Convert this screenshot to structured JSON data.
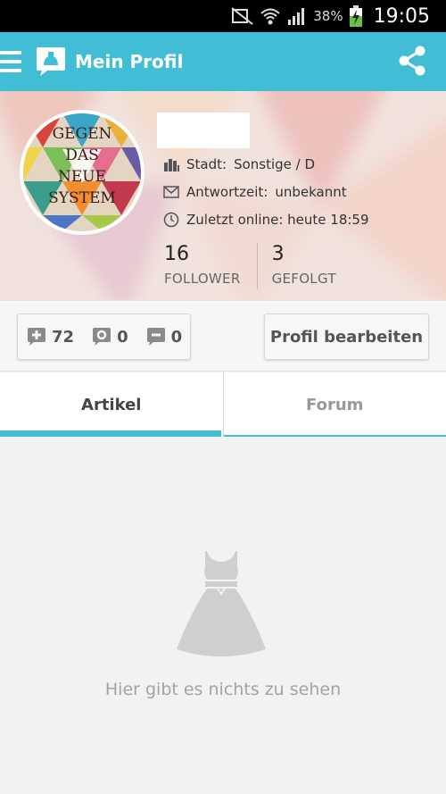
{
  "status_bar": {
    "battery": "38%",
    "time": "19:05"
  },
  "app_bar": {
    "title": "Mein Profil"
  },
  "profile": {
    "avatar_text": [
      "GEGEN",
      "DAS",
      "NEUE",
      "SYSTEM"
    ],
    "city_label": "Stadt:",
    "city_value": "Sonstige / D",
    "response_label": "Antwortzeit:",
    "response_value": "unbekannt",
    "online_text": "Zuletzt online: heute 18:59",
    "followers_count": "16",
    "followers_label": "FOLLOWER",
    "following_count": "3",
    "following_label": "GEFOLGT"
  },
  "actions": {
    "positive_count": "72",
    "neutral_count": "0",
    "negative_count": "0",
    "edit_label": "Profil bearbeiten"
  },
  "tabs": [
    {
      "label": "Artikel",
      "active": true
    },
    {
      "label": "Forum",
      "active": false
    }
  ],
  "empty_state": {
    "message": "Hier gibt es nichts zu sehen"
  },
  "colors": {
    "accent": "#41bdd6",
    "status_bar": "#000000",
    "background": "#f2f2f2"
  }
}
